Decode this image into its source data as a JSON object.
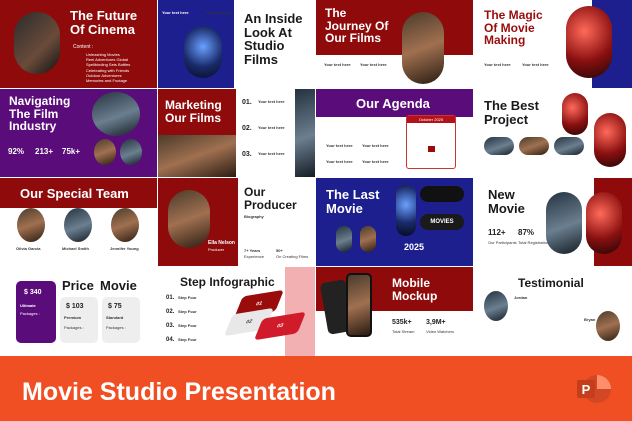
{
  "banner": {
    "title": "Movie Studio Presentation",
    "app_icon_letter": "P",
    "color": "#f04e23"
  },
  "colors": {
    "red": "#8f0a0a",
    "purple": "#5a0d7a",
    "navy": "#1d1f8f",
    "white": "#ffffff"
  },
  "slides": {
    "future": {
      "title_l1": "The Future",
      "title_l2": "Of Cinema",
      "content_label": "Content :",
      "items": [
        "Unleashing Movies",
        "Reel Adventures Global",
        "Spellbinding Sets Bottles",
        "Celebrating with Friends",
        "Outdoor Adventures",
        "Memories and Footage"
      ]
    },
    "inside": {
      "title_l1": "An Inside",
      "title_l2": "Look At",
      "title_l3": "Studio",
      "title_l4": "Films",
      "label_a": "Your text here",
      "label_b": "Your text here"
    },
    "journey": {
      "title_l1": "The",
      "title_l2": "Journey Of",
      "title_l3": "Our Films",
      "label_a": "Your text here",
      "label_b": "Your text here"
    },
    "magic": {
      "title_l1": "The Magic",
      "title_l2": "Of Movie",
      "title_l3": "Making",
      "label_a": "Your text here",
      "label_b": "Your text here"
    },
    "navigating": {
      "title_l1": "Navigating",
      "title_l2": "The Film",
      "title_l3": "Industry",
      "stat_a": "92%",
      "stat_b": "213+",
      "stat_c": "75k+"
    },
    "marketing": {
      "title_l1": "Marketing",
      "title_l2": "Our Films",
      "n1": "01.",
      "n2": "02.",
      "n3": "03.",
      "label": "Your text here"
    },
    "agenda": {
      "title": "Our Agenda",
      "calendar_label": "October 2025",
      "label": "Your text here"
    },
    "best": {
      "title_l1": "The Best",
      "title_l2": "Project"
    },
    "team": {
      "title": "Our Special Team",
      "names": [
        "Olivia Garcia",
        "Michael Smith",
        "Jennifer Young"
      ]
    },
    "producer": {
      "title_l1": "Our",
      "title_l2": "Producer",
      "bio_label": "Biography",
      "name": "Ella Nelson",
      "role": "Producer",
      "stat_a": "7+ Years",
      "stat_a_lab": "Experience",
      "stat_b": "50+",
      "stat_b_lab": "On Creating Films"
    },
    "lastmovie": {
      "title_l1": "The Last",
      "title_l2": "Movie",
      "year": "2025",
      "ticket": "MOVIES"
    },
    "newmovie": {
      "title_l1": "New",
      "title_l2": "Movie",
      "stat_a": "112+",
      "stat_a_lab": "Our Participants",
      "stat_b": "87%",
      "stat_b_lab": "Total Registration"
    },
    "price": {
      "title_l1": "Price",
      "title_l2": "Movie",
      "card_a": "$ 340",
      "card_a_name": "Ultimate",
      "card_b": "$ 103",
      "card_b_name": "Premium",
      "card_c": "$ 75",
      "card_c_name": "Standard",
      "packages": "Packages :"
    },
    "step": {
      "title": "Step Infographic",
      "n1": "01.",
      "n2": "02.",
      "n3": "03.",
      "n4": "04.",
      "step_label": "Step Four",
      "layer_a": "01",
      "layer_b": "02",
      "layer_c": "03"
    },
    "mobile": {
      "title_l1": "Mobile",
      "title_l2": "Mockup",
      "stat_a": "535k+",
      "stat_a_lab": "Total Stream",
      "stat_b": "3,9M+",
      "stat_b_lab": "Video Watchers"
    },
    "testimonial": {
      "title": "Testimonial",
      "name_a": "Jordan",
      "name_b": "Bryan"
    }
  }
}
